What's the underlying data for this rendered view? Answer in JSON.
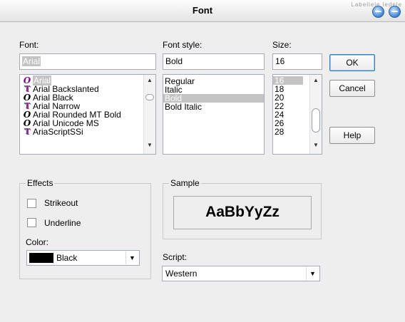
{
  "window": {
    "title": "Font",
    "ghost_text": "Labellele ledele"
  },
  "font": {
    "label": "Font:",
    "value": "Arial",
    "items": [
      {
        "name": "Arial",
        "icon": "o"
      },
      {
        "name": "Arial Backslanted",
        "icon": "tt"
      },
      {
        "name": "Arial Black",
        "icon": "o"
      },
      {
        "name": "Arial Narrow",
        "icon": "tt"
      },
      {
        "name": "Arial Rounded MT Bold",
        "icon": "o"
      },
      {
        "name": "Arial Unicode MS",
        "icon": "o"
      },
      {
        "name": "AriaScriptSSi",
        "icon": "tt"
      }
    ],
    "selected_index": 0
  },
  "font_style": {
    "label": "Font style:",
    "value": "Bold",
    "items": [
      "Regular",
      "Italic",
      "Bold",
      "Bold Italic"
    ],
    "selected_index": 2
  },
  "size": {
    "label": "Size:",
    "value": "16",
    "items": [
      "16",
      "18",
      "20",
      "22",
      "24",
      "26",
      "28"
    ],
    "selected_index": 0
  },
  "buttons": {
    "ok": "OK",
    "cancel": "Cancel",
    "help": "Help"
  },
  "effects": {
    "label": "Effects",
    "strikeout": "Strikeout",
    "underline": "Underline",
    "strikeout_checked": false,
    "underline_checked": false,
    "color_label": "Color:",
    "color_value": "Black",
    "color_hex": "#000000"
  },
  "sample": {
    "label": "Sample",
    "text": "AaBbYyZz"
  },
  "script": {
    "label": "Script:",
    "value": "Western"
  }
}
